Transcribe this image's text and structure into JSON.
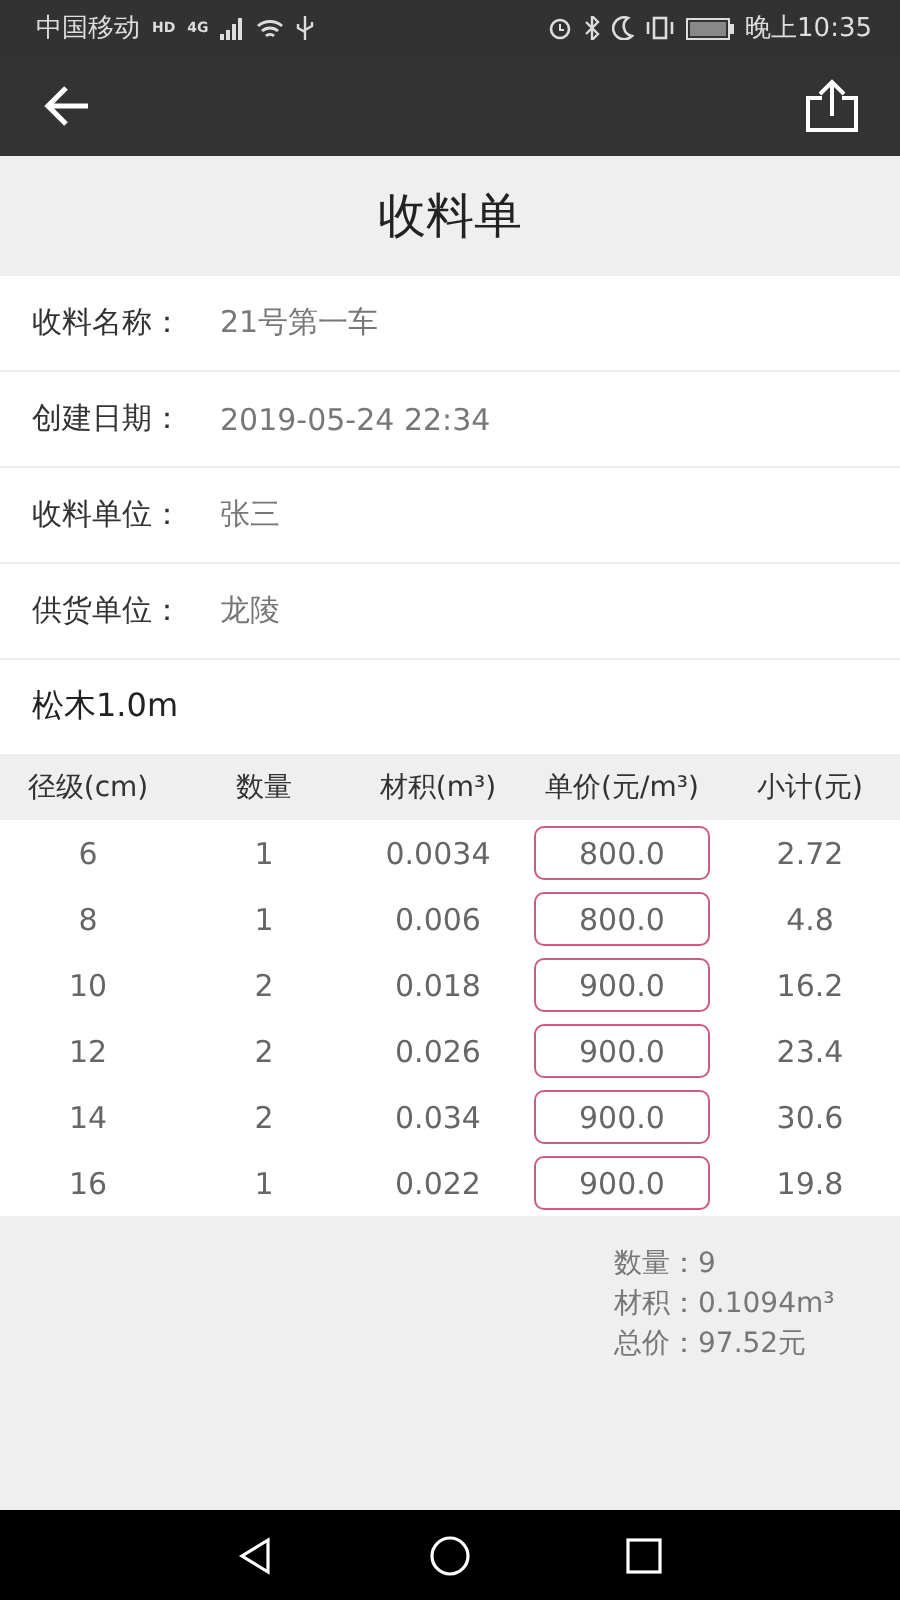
{
  "status_bar": {
    "carrier": "中国移动",
    "badges": [
      "HD",
      "4G"
    ],
    "time": "晚上10:35"
  },
  "title": "收料单",
  "fields": [
    {
      "label": "收料名称：",
      "value": "21号第一车"
    },
    {
      "label": "创建日期：",
      "value": "2019-05-24 22:34"
    },
    {
      "label": "收料单位：",
      "value": "张三"
    },
    {
      "label": "供货单位：",
      "value": "龙陵"
    }
  ],
  "wood_type": "松木1.0m",
  "table": {
    "columns": [
      "径级(cm)",
      "数量",
      "材积(m³)",
      "单价(元/m³)",
      "小计(元)"
    ],
    "rows": [
      [
        "6",
        "1",
        "0.0034",
        "800.0",
        "2.72"
      ],
      [
        "8",
        "1",
        "0.006",
        "800.0",
        "4.8"
      ],
      [
        "10",
        "2",
        "0.018",
        "900.0",
        "16.2"
      ],
      [
        "12",
        "2",
        "0.026",
        "900.0",
        "23.4"
      ],
      [
        "14",
        "2",
        "0.034",
        "900.0",
        "30.6"
      ],
      [
        "16",
        "1",
        "0.022",
        "900.0",
        "19.8"
      ]
    ]
  },
  "summary": [
    "数量：9",
    "材积：0.1094m³",
    "总价：97.52元"
  ]
}
